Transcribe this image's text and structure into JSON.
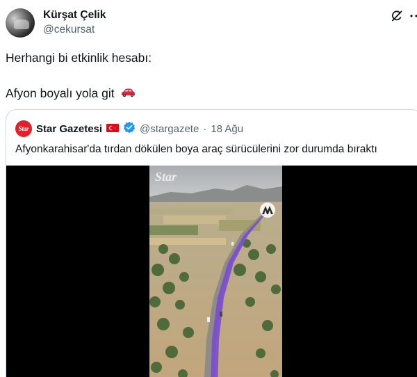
{
  "author": {
    "name": "Kürşat Çelik",
    "handle": "@cekursat"
  },
  "tweet": {
    "line1": "Herhangi bi etkinlik hesabı:",
    "line2": "Afyon boyalı yola git",
    "emoji": "🚗"
  },
  "quote": {
    "logo_text": "Star",
    "name": "Star Gazetesi",
    "handle": "@stargazete",
    "separator": "·",
    "date": "18 Ağu",
    "text": "Afyonkarahisar'da tırdan dökülen boya araç sürücülerini zor durumda bıraktı",
    "video_watermark": "Star",
    "colors": {
      "logo": "#e0202a",
      "verified": "#1d9bf0",
      "road_paint": "#7a4bd0"
    }
  },
  "icons": [
    "avatar",
    "grok-icon",
    "more-icon",
    "car-emoji",
    "turkey-flag-icon",
    "verified-icon",
    "aa-logo-icon"
  ]
}
